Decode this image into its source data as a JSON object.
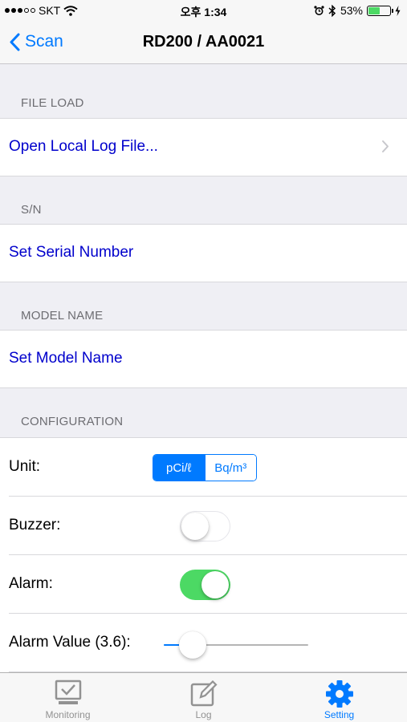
{
  "status_bar": {
    "carrier": "SKT",
    "time": "오후 1:34",
    "battery_percent": "53%",
    "battery_level": 0.53
  },
  "nav": {
    "back_label": "Scan",
    "title": "RD200 / AA0021"
  },
  "sections": {
    "file_load": {
      "header": "FILE LOAD",
      "item": "Open Local Log File..."
    },
    "sn": {
      "header": "S/N",
      "item": "Set Serial Number"
    },
    "model_name": {
      "header": "MODEL NAME",
      "item": "Set Model Name"
    },
    "configuration": {
      "header": "CONFIGURATION",
      "unit_label": "Unit:",
      "unit_options": [
        "pCi/ℓ",
        "Bq/m³"
      ],
      "unit_selected": "pCi/ℓ",
      "buzzer_label": "Buzzer:",
      "buzzer_on": false,
      "alarm_label": "Alarm:",
      "alarm_on": true,
      "alarm_value_label": "Alarm Value (3.6):",
      "alarm_value_fraction": 0.2
    }
  },
  "tab_bar": {
    "tabs": [
      {
        "label": "Monitoring",
        "icon": "monitor-check-icon",
        "active": false
      },
      {
        "label": "Log",
        "icon": "edit-note-icon",
        "active": false
      },
      {
        "label": "Setting",
        "icon": "gear-icon",
        "active": true
      }
    ]
  },
  "colors": {
    "accent": "#007aff",
    "link": "#0000cc",
    "toggle_on": "#4cd964",
    "battery": "#4cd964"
  }
}
